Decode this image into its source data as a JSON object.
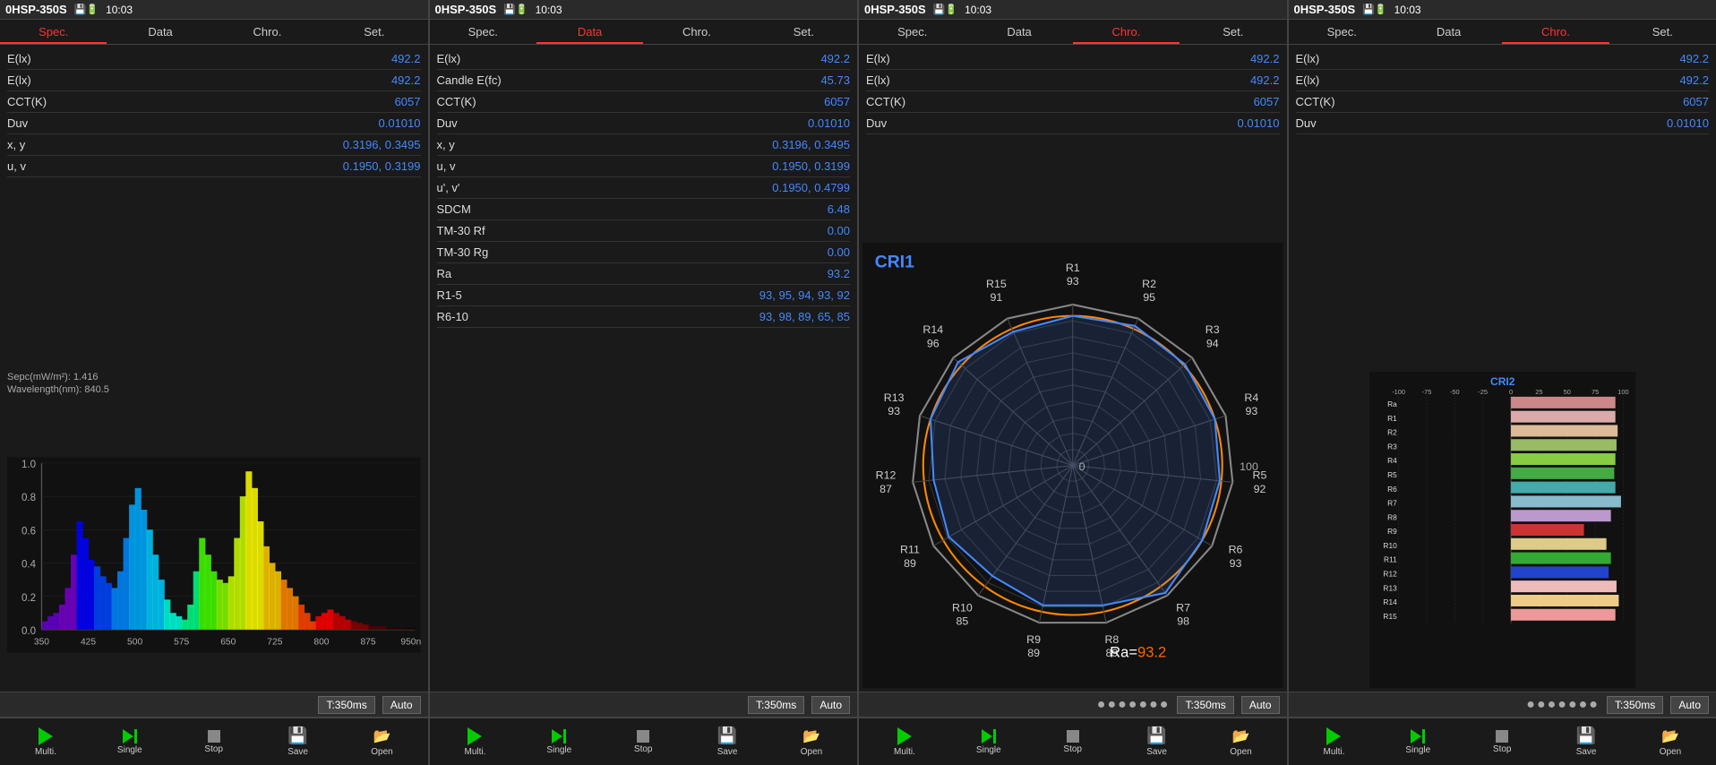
{
  "panels": [
    {
      "id": "panel1",
      "header": {
        "device": "0HSP-350S",
        "icon": "💾",
        "battery": "🔋",
        "time": "10:03"
      },
      "tabs": [
        {
          "label": "Spec.",
          "active": true,
          "style": "active-red"
        },
        {
          "label": "Data",
          "active": false,
          "style": ""
        },
        {
          "label": "Chro.",
          "active": false,
          "style": ""
        },
        {
          "label": "Set.",
          "active": false,
          "style": ""
        }
      ],
      "activeTab": "Spec.",
      "dataRows": [
        {
          "label": "E(lx)",
          "value": "492.2"
        },
        {
          "label": "E(lx)",
          "value": "492.2"
        },
        {
          "label": "CCT(K)",
          "value": "6057"
        },
        {
          "label": "Duv",
          "value": "0.01010"
        },
        {
          "label": "x, y",
          "value": "0.3196, 0.3495"
        },
        {
          "label": "u, v",
          "value": "0.1950, 0.3199"
        }
      ],
      "spectrum": {
        "sepc": "Sepc(mW/m²): 1.416",
        "wavelength": "Wavelength(nm): 840.5",
        "xMin": "350",
        "xMax": "950nm",
        "yMin": "0.0",
        "yMax": "1.0"
      },
      "statusBar": {
        "dots": false,
        "time": "T:350ms",
        "auto": "Auto"
      },
      "toolbar": {
        "buttons": [
          {
            "label": "Multi.",
            "type": "play"
          },
          {
            "label": "Single",
            "type": "skip"
          },
          {
            "label": "Stop",
            "type": "stop"
          },
          {
            "label": "Save",
            "type": "save"
          },
          {
            "label": "Open",
            "type": "open"
          }
        ]
      }
    },
    {
      "id": "panel2",
      "header": {
        "device": "0HSP-350S",
        "icon": "💾",
        "battery": "🔋",
        "time": "10:03"
      },
      "tabs": [
        {
          "label": "Spec.",
          "active": false,
          "style": ""
        },
        {
          "label": "Data",
          "active": true,
          "style": "active-red"
        },
        {
          "label": "Chro.",
          "active": false,
          "style": ""
        },
        {
          "label": "Set.",
          "active": false,
          "style": ""
        }
      ],
      "activeTab": "Data",
      "dataRows": [
        {
          "label": "E(lx)",
          "value": "492.2"
        },
        {
          "label": "Candle E(fc)",
          "value": "45.73"
        },
        {
          "label": "CCT(K)",
          "value": "6057"
        },
        {
          "label": "Duv",
          "value": "0.01010"
        },
        {
          "label": "x, y",
          "value": "0.3196, 0.3495"
        },
        {
          "label": "u, v",
          "value": "0.1950, 0.3199"
        },
        {
          "label": "u', v'",
          "value": "0.1950, 0.4799"
        },
        {
          "label": "SDCM",
          "value": "6.48"
        },
        {
          "label": "TM-30 Rf",
          "value": "0.00"
        },
        {
          "label": "TM-30 Rg",
          "value": "0.00"
        },
        {
          "label": "Ra",
          "value": "93.2"
        },
        {
          "label": "R1-5",
          "value": "93, 95, 94, 93, 92"
        },
        {
          "label": "R6-10",
          "value": "93, 98, 89, 65, 85"
        }
      ],
      "statusBar": {
        "dots": false,
        "time": "T:350ms",
        "auto": "Auto"
      },
      "toolbar": {
        "buttons": [
          {
            "label": "Multi.",
            "type": "play"
          },
          {
            "label": "Single",
            "type": "skip"
          },
          {
            "label": "Stop",
            "type": "stop"
          },
          {
            "label": "Save",
            "type": "save"
          },
          {
            "label": "Open",
            "type": "open"
          }
        ]
      }
    },
    {
      "id": "panel3",
      "header": {
        "device": "0HSP-350S",
        "icon": "💾",
        "battery": "🔋",
        "time": "10:03"
      },
      "tabs": [
        {
          "label": "Spec.",
          "active": false,
          "style": ""
        },
        {
          "label": "Data",
          "active": false,
          "style": ""
        },
        {
          "label": "Chro.",
          "active": true,
          "style": "active-red"
        },
        {
          "label": "Set.",
          "active": false,
          "style": ""
        }
      ],
      "activeTab": "Chro.",
      "dataRows": [
        {
          "label": "E(lx)",
          "value": "492.2"
        },
        {
          "label": "E(lx)",
          "value": "492.2"
        },
        {
          "label": "CCT(K)",
          "value": "6057"
        },
        {
          "label": "Duv",
          "value": "0.01010"
        }
      ],
      "cri": {
        "title": "CRI1",
        "raLabel": "Ra=93.2",
        "outerLabels": [
          {
            "text": "R1\n93",
            "angle": 90
          },
          {
            "text": "R2\n95",
            "angle": 66
          },
          {
            "text": "R3\n94",
            "angle": 42
          },
          {
            "text": "R4\n93",
            "angle": 18
          },
          {
            "text": "R5\n92",
            "angle": -6
          },
          {
            "text": "R6\n93",
            "angle": -30
          },
          {
            "text": "R7\n98",
            "angle": -54
          },
          {
            "text": "R8\n89",
            "angle": -78
          },
          {
            "text": "R9\n89",
            "angle": -102
          },
          {
            "text": "R10\n85",
            "angle": -126
          },
          {
            "text": "R11\n89",
            "angle": -150
          },
          {
            "text": "R12\n87",
            "angle": -174
          },
          {
            "text": "R13\n93",
            "angle": 162
          },
          {
            "text": "R14\n96",
            "angle": 138
          },
          {
            "text": "R15\n91",
            "angle": 114
          }
        ]
      },
      "statusBar": {
        "dots": true,
        "time": "T:350ms",
        "auto": "Auto"
      },
      "toolbar": {
        "buttons": [
          {
            "label": "Multi.",
            "type": "play"
          },
          {
            "label": "Single",
            "type": "skip"
          },
          {
            "label": "Stop",
            "type": "stop"
          },
          {
            "label": "Save",
            "type": "save"
          },
          {
            "label": "Open",
            "type": "open"
          }
        ]
      }
    },
    {
      "id": "panel4",
      "header": {
        "device": "0HSP-350S",
        "icon": "💾",
        "battery": "🔋",
        "time": "10:03"
      },
      "tabs": [
        {
          "label": "Spec.",
          "active": false,
          "style": ""
        },
        {
          "label": "Data",
          "active": false,
          "style": ""
        },
        {
          "label": "Chro.",
          "active": true,
          "style": "active-red"
        },
        {
          "label": "Set.",
          "active": false,
          "style": ""
        }
      ],
      "activeTab": "Chro.",
      "dataRows": [
        {
          "label": "E(lx)",
          "value": "492.2"
        },
        {
          "label": "E(lx)",
          "value": "492.2"
        },
        {
          "label": "CCT(K)",
          "value": "6057"
        },
        {
          "label": "Duv",
          "value": "0.01010"
        }
      ],
      "cri2": {
        "title": "CRI2",
        "axisLabels": [
          "-100",
          "-75",
          "-50",
          "-25",
          "0",
          "25",
          "50",
          "75",
          "100"
        ],
        "bars": [
          {
            "label": "Ra",
            "value": 93,
            "color": "#cc8888"
          },
          {
            "label": "R1",
            "value": 93,
            "color": "#ddaaaa"
          },
          {
            "label": "R2",
            "value": 95,
            "color": "#ddbb99"
          },
          {
            "label": "R3",
            "value": 94,
            "color": "#99bb66"
          },
          {
            "label": "R4",
            "value": 93,
            "color": "#88cc44"
          },
          {
            "label": "R5",
            "value": 92,
            "color": "#44aa44"
          },
          {
            "label": "R6",
            "value": 93,
            "color": "#44aaaa"
          },
          {
            "label": "R7",
            "value": 98,
            "color": "#88bbcc"
          },
          {
            "label": "R8",
            "value": 89,
            "color": "#bb99cc"
          },
          {
            "label": "R9",
            "value": 65,
            "color": "#cc3333"
          },
          {
            "label": "R10",
            "value": 85,
            "color": "#ddcc88"
          },
          {
            "label": "R11",
            "value": 89,
            "color": "#33aa33"
          },
          {
            "label": "R12",
            "value": 87,
            "color": "#2244cc"
          },
          {
            "label": "R13",
            "value": 94,
            "color": "#eebbbb"
          },
          {
            "label": "R14",
            "value": 96,
            "color": "#eecc88"
          },
          {
            "label": "R15",
            "value": 93,
            "color": "#ee9999"
          }
        ]
      },
      "statusBar": {
        "dots": true,
        "time": "T:350ms",
        "auto": "Auto"
      },
      "toolbar": {
        "buttons": [
          {
            "label": "Multi.",
            "type": "play"
          },
          {
            "label": "Single",
            "type": "skip"
          },
          {
            "label": "Stop",
            "type": "stop"
          },
          {
            "label": "Save",
            "type": "save"
          },
          {
            "label": "Open",
            "type": "open"
          }
        ]
      }
    }
  ]
}
